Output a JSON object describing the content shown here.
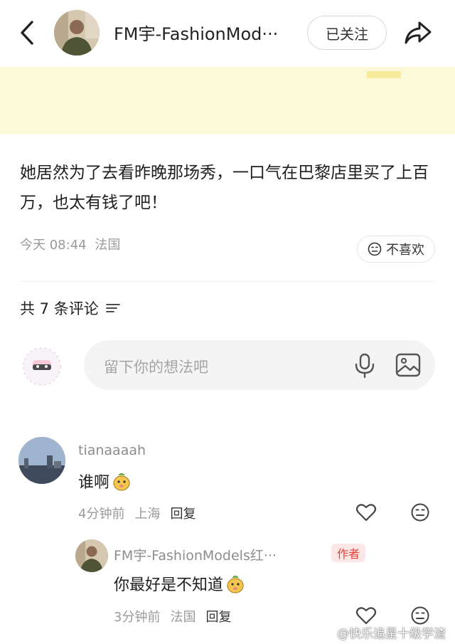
{
  "header": {
    "author_name": "FM宇-FashionMod···",
    "follow_label": "已关注"
  },
  "post": {
    "text": "她居然为了去看昨晚那场秀，一口气在巴黎店里买了上百万，也太有钱了吧！",
    "time": "今天 08:44",
    "location": "法国",
    "dislike_label": "不喜欢"
  },
  "comments_section": {
    "count_label": "共 7 条评论",
    "input_placeholder": "留下你的想法吧"
  },
  "comments": [
    {
      "user": "tianaaaah",
      "text": "谁啊",
      "time": "4分钟前",
      "location": "上海",
      "reply_label": "回复"
    }
  ],
  "reply": {
    "user": "FM宇-FashionModels红···",
    "tag": "作者",
    "text": "你最好是不知道",
    "time": "3分钟前",
    "location": "法国",
    "reply_label": "回复"
  },
  "watermark": "@快乐追星十级学渣",
  "colors": {
    "banner": "#fbf9d7",
    "author_tag_text": "#e8413c",
    "author_tag_bg": "#fde6e6"
  }
}
